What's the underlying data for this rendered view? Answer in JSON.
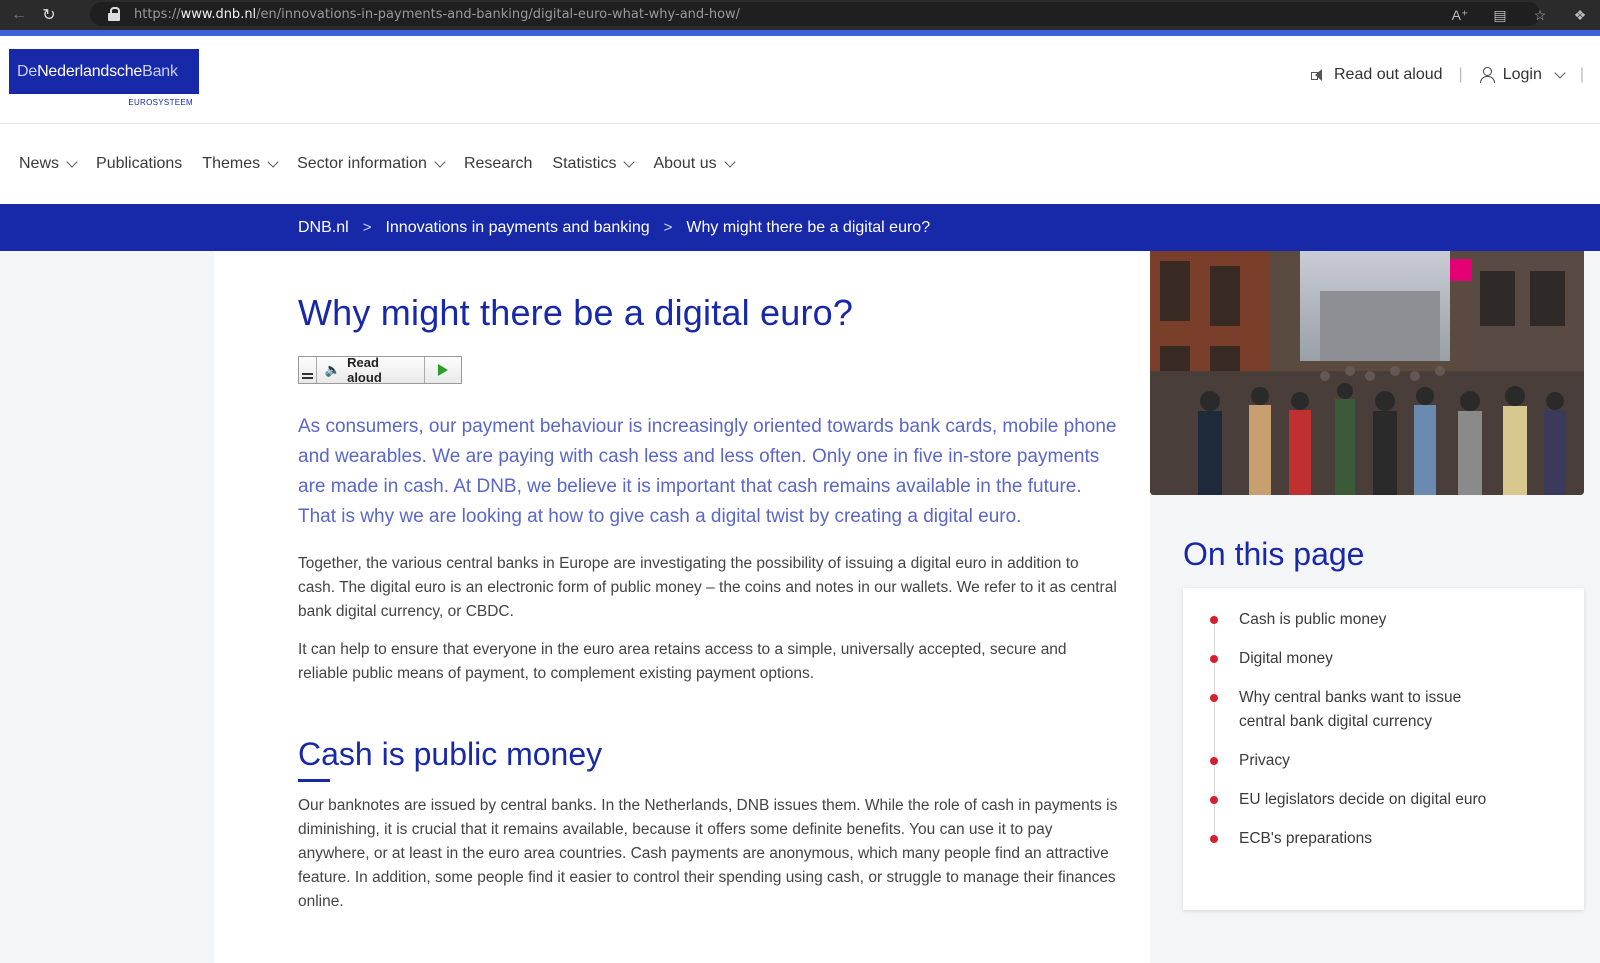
{
  "browser": {
    "url_prefix": "https://",
    "url_domain": "www.dnb.nl",
    "url_path": "/en/innovations-in-payments-and-banking/digital-euro-what-why-and-how/"
  },
  "logo": {
    "part1": "De",
    "part2": "Nederlandsche",
    "part3": "Bank",
    "sub": "EUROSYSTEEM"
  },
  "header": {
    "read_out_aloud": "Read out aloud",
    "login": "Login"
  },
  "nav": {
    "items": [
      {
        "label": "News",
        "dropdown": true
      },
      {
        "label": "Publications",
        "dropdown": false
      },
      {
        "label": "Themes",
        "dropdown": true
      },
      {
        "label": "Sector information",
        "dropdown": true
      },
      {
        "label": "Research",
        "dropdown": false
      },
      {
        "label": "Statistics",
        "dropdown": true
      },
      {
        "label": "About us",
        "dropdown": true
      }
    ]
  },
  "breadcrumb": {
    "items": [
      "DNB.nl",
      "Innovations in payments and banking",
      "Why might there be a digital euro?"
    ]
  },
  "article": {
    "title": "Why might there be a digital euro?",
    "read_aloud_label": "Read aloud",
    "intro": "As consumers, our payment behaviour is increasingly oriented towards bank cards, mobile phone and wearables. We are paying with cash less and less often. Only one in five in-store payments are made in cash. At DNB, we believe it is important that cash remains available in the future. That is why we are looking at how to give cash a digital twist by creating a digital euro.",
    "paragraphs": [
      "Together, the various central banks in Europe are investigating the possibility of issuing a digital euro in addition to cash. The digital euro is an electronic form of public money – the coins and notes in our wallets. We refer to it as central bank digital currency, or CBDC.",
      "It can help to ensure that everyone in the euro area retains access to a simple, universally accepted, secure and reliable public means of payment, to complement existing payment options."
    ],
    "section1_title": "Cash is public money",
    "section1_body": "Our banknotes are issued by central banks. In the Netherlands, DNB issues them. While the role of cash in payments is diminishing, it is crucial that it remains available, because it offers some definite benefits. You can use it to pay anywhere, or at least in the euro area countries. Cash payments are anonymous, which many people find an attractive feature. In addition, some people find it easier to control their spending using cash, or struggle to manage their finances online."
  },
  "on_this_page": {
    "title": "On this page",
    "items": [
      "Cash is public money",
      "Digital money",
      "Why central banks want to issue central bank digital currency",
      "Privacy",
      "EU legislators decide on digital euro",
      "ECB's preparations"
    ]
  },
  "colors": {
    "brand_blue": "#1728a8",
    "intro_blue": "#5a66c8",
    "bullet_red": "#d4202f"
  }
}
